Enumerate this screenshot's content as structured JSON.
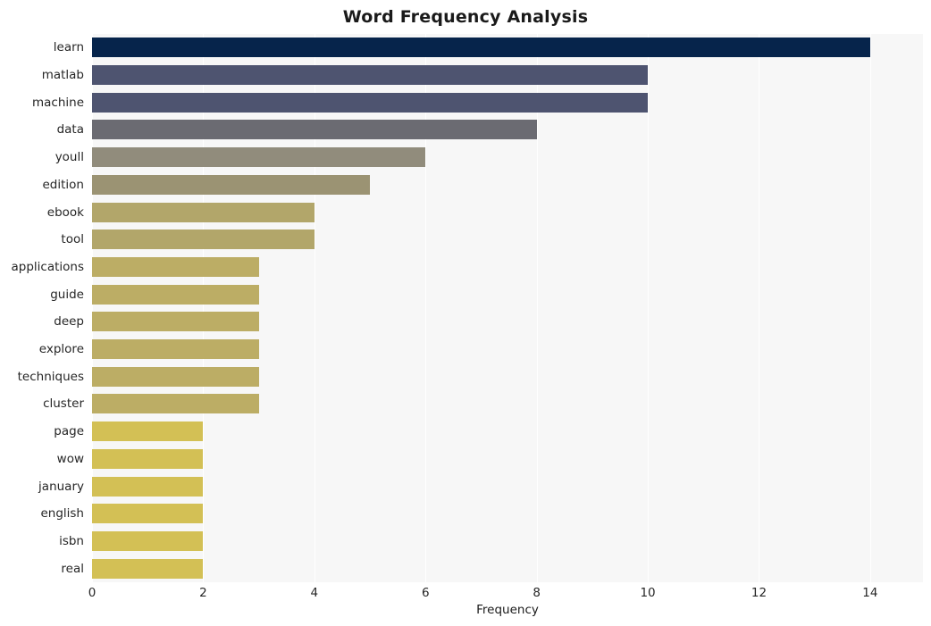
{
  "chart_data": {
    "type": "bar",
    "orientation": "horizontal",
    "title": "Word Frequency Analysis",
    "xlabel": "Frequency",
    "ylabel": "",
    "categories": [
      "learn",
      "matlab",
      "machine",
      "data",
      "youll",
      "edition",
      "ebook",
      "tool",
      "applications",
      "guide",
      "deep",
      "explore",
      "techniques",
      "cluster",
      "page",
      "wow",
      "january",
      "english",
      "isbn",
      "real"
    ],
    "values": [
      14,
      10,
      10,
      8,
      6,
      5,
      4,
      4,
      3,
      3,
      3,
      3,
      3,
      3,
      2,
      2,
      2,
      2,
      2,
      2
    ],
    "bar_colors": [
      "#06244b",
      "#4e5470",
      "#4e5470",
      "#6b6b72",
      "#918c7c",
      "#9b9373",
      "#b2a66a",
      "#b2a66a",
      "#bcad65",
      "#bcad65",
      "#bcad65",
      "#bcad65",
      "#bcad65",
      "#bcad65",
      "#d3c055",
      "#d3c055",
      "#d3c055",
      "#d3c055",
      "#d3c055",
      "#d3c055"
    ],
    "xlim": [
      0,
      14.95
    ],
    "xticks": [
      0,
      2,
      4,
      6,
      8,
      10,
      12,
      14
    ],
    "xtick_labels": [
      "0",
      "2",
      "4",
      "6",
      "8",
      "10",
      "12",
      "14"
    ],
    "grid": true,
    "grid_axis": "x",
    "plot_background": "#f7f7f7",
    "grid_color": "#ffffff",
    "figure_background": "#ffffff",
    "legend": null
  }
}
